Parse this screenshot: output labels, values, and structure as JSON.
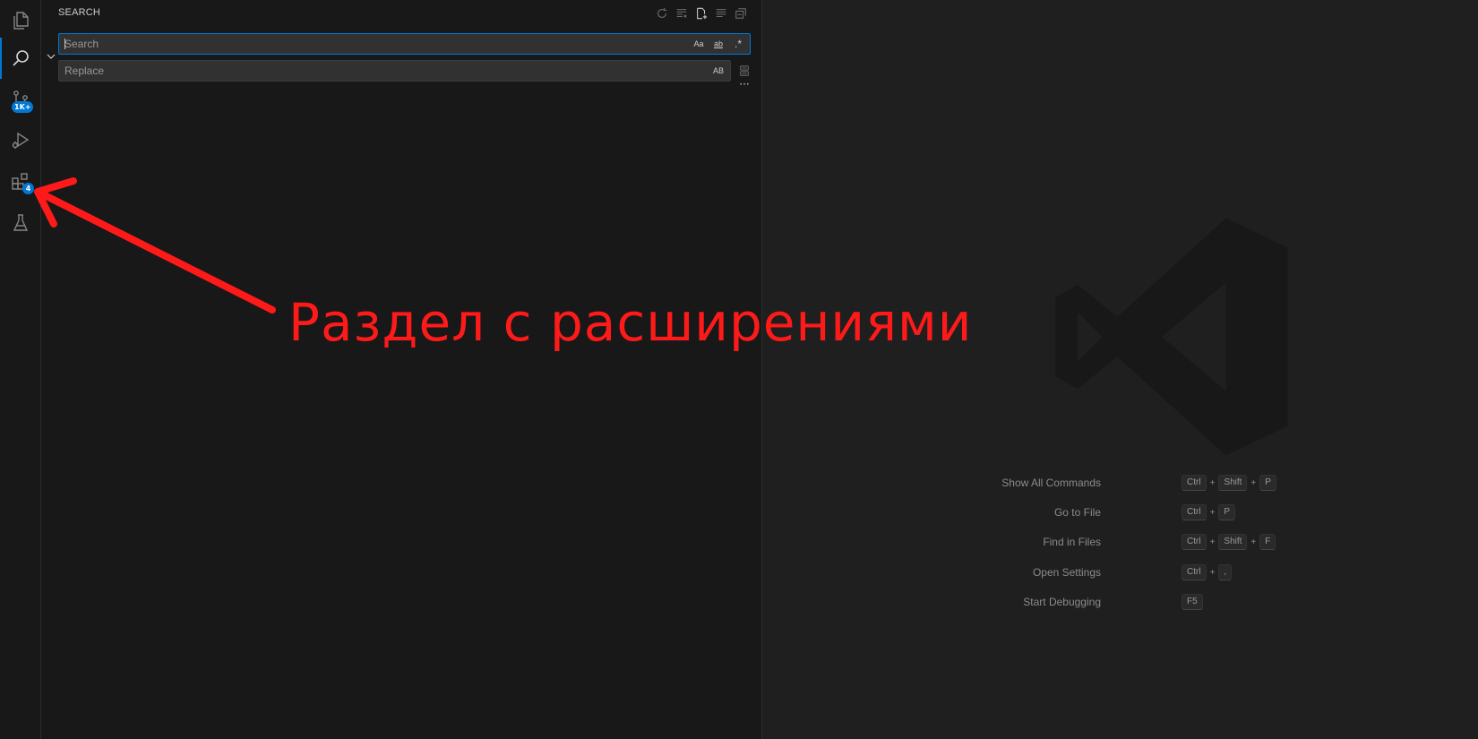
{
  "sidebar": {
    "title": "SEARCH",
    "search": {
      "placeholder": "Search",
      "toggles": [
        "Aa",
        "ab",
        ".*"
      ]
    },
    "replace": {
      "placeholder": "Replace",
      "toggle": "AB"
    },
    "more": "···"
  },
  "activity_bar": {
    "items": [
      {
        "name": "explorer",
        "icon": "files-icon"
      },
      {
        "name": "search",
        "icon": "search-icon",
        "active": true
      },
      {
        "name": "source-control",
        "icon": "source-control-icon",
        "badge": "1K+"
      },
      {
        "name": "run-and-debug",
        "icon": "run-debug-icon"
      },
      {
        "name": "extensions",
        "icon": "extensions-icon",
        "badge": "4"
      },
      {
        "name": "testing",
        "icon": "flask-icon"
      }
    ]
  },
  "editor": {
    "shortcuts": [
      {
        "label": "Show All Commands",
        "keys": [
          "Ctrl",
          "Shift",
          "P"
        ]
      },
      {
        "label": "Go to File",
        "keys": [
          "Ctrl",
          "P"
        ]
      },
      {
        "label": "Find in Files",
        "keys": [
          "Ctrl",
          "Shift",
          "F"
        ]
      },
      {
        "label": "Open Settings",
        "keys": [
          "Ctrl",
          ","
        ]
      },
      {
        "label": "Start Debugging",
        "keys": [
          "F5"
        ]
      }
    ]
  },
  "annotation": {
    "text": "Раздел с расширениями",
    "color": "#ff1a1a"
  },
  "colors": {
    "accent": "#0078d4",
    "sidebar_bg": "#181818",
    "editor_bg": "#1f1f1f"
  }
}
